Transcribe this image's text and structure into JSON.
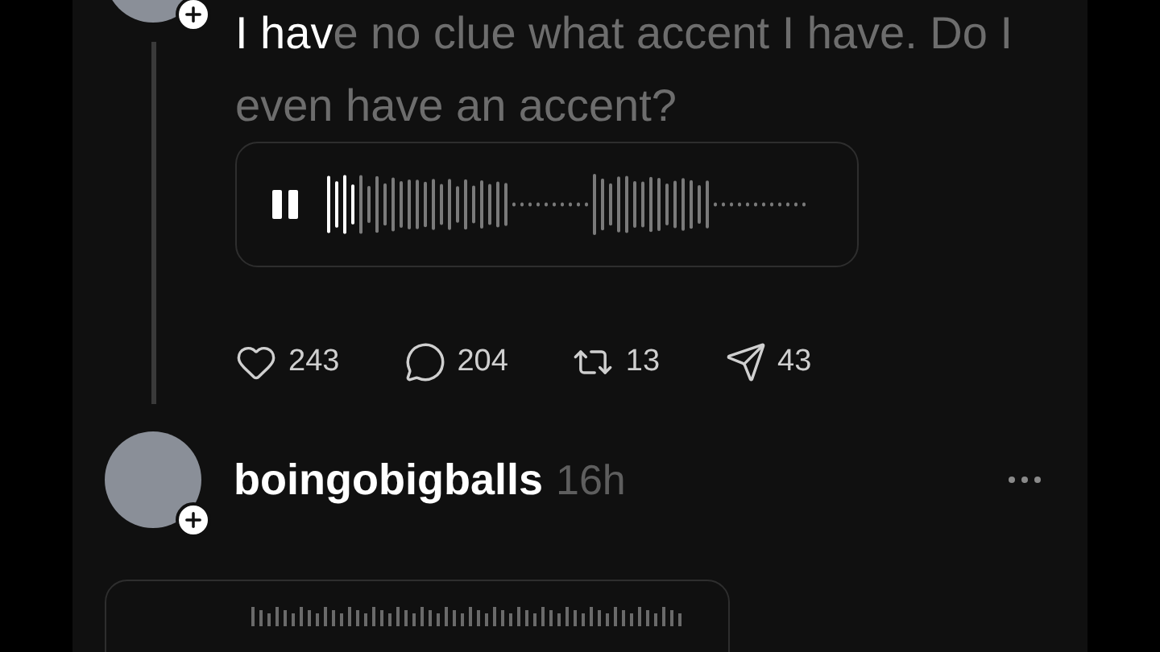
{
  "post": {
    "caption_spoken": "I hav",
    "caption_rest": "e no clue what accent I have. Do I even have an accent?",
    "audio": {
      "playing": true,
      "level": 0.06
    },
    "actions": [
      {
        "kind": "like",
        "count": "243"
      },
      {
        "kind": "reply",
        "count": "204"
      },
      {
        "kind": "repost",
        "count": "13"
      },
      {
        "kind": "share",
        "count": "43"
      }
    ]
  },
  "next_post": {
    "username": "boingobigballs",
    "time": "16h"
  }
}
